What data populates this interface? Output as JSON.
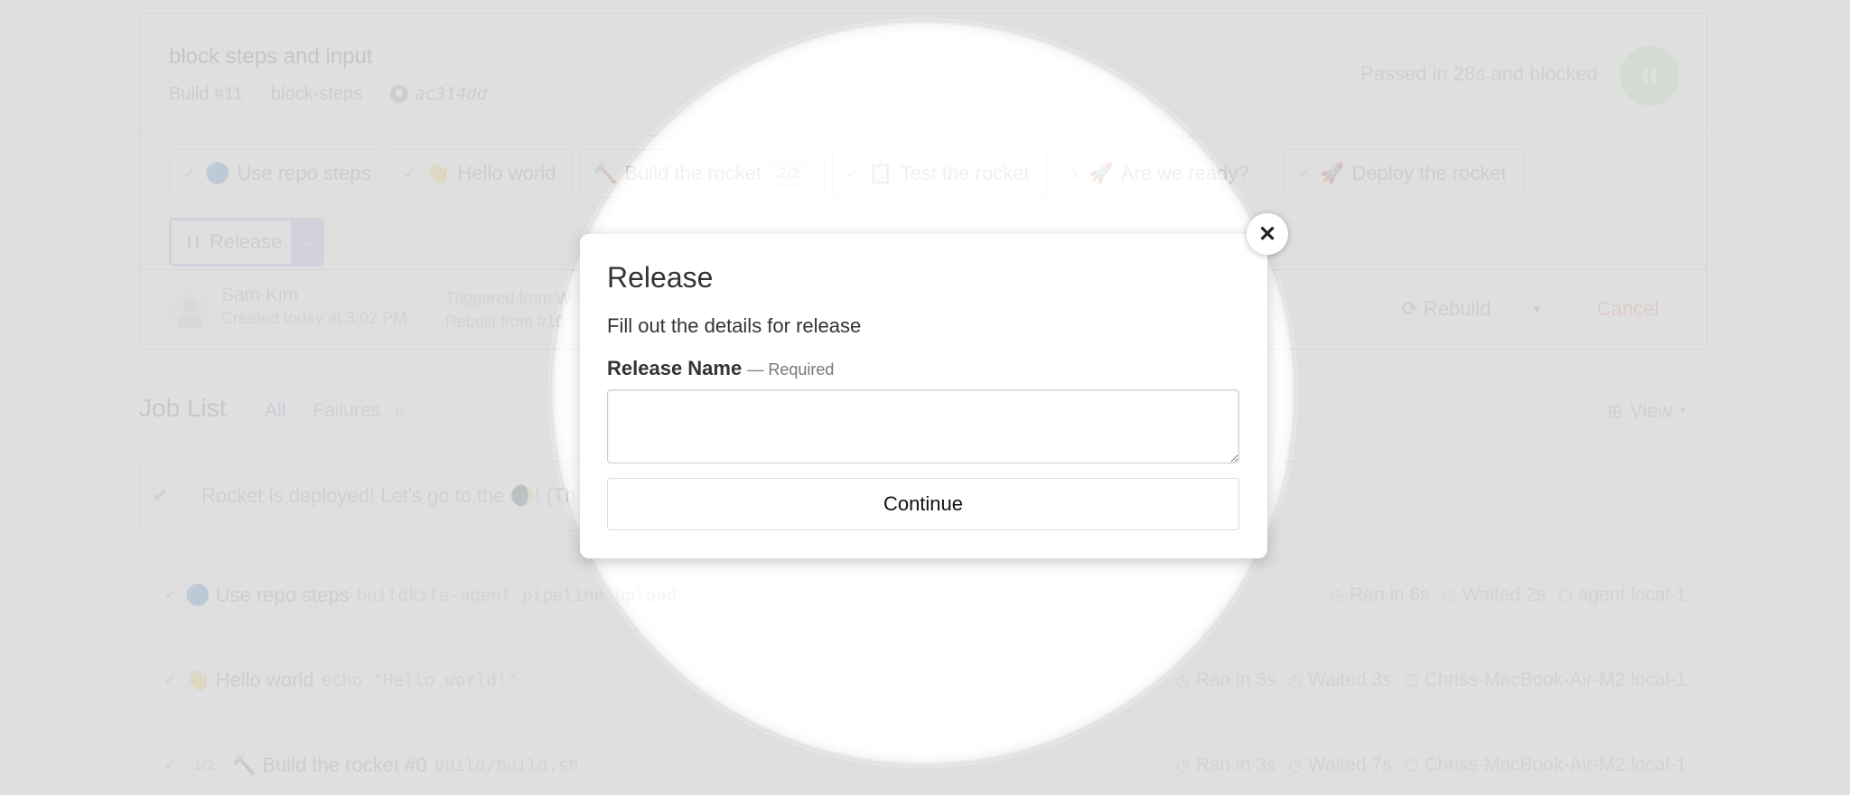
{
  "build": {
    "title": "block steps and input",
    "number": "Build #11",
    "branch": "block-steps",
    "commit": "ac314dd",
    "status_text": "Passed in 28s and blocked",
    "status_color": "#b7e5aa",
    "status_icon": "pause-icon"
  },
  "pipeline_steps": [
    {
      "state": "passed",
      "emoji": "🔵",
      "label": "Use repo steps"
    },
    {
      "state": "passed",
      "emoji": "👋",
      "label": "Hello world"
    },
    {
      "state": "passed",
      "emoji": "🔨",
      "label": "Build the rocket",
      "count": "2/2"
    },
    {
      "state": "passed",
      "emoji": "📋",
      "label": "Test the rocket"
    },
    {
      "state": "wait",
      "emoji": "🚀",
      "label": "Are we ready?"
    },
    {
      "state": "passed",
      "emoji": "🚀",
      "label": "Deploy the rocket"
    }
  ],
  "release_step": {
    "label": "Release",
    "state": "blocked",
    "accent": "#b4a4f0"
  },
  "creator": {
    "name": "Sam Kim",
    "created": "Created today at 3:02 PM",
    "triggered": "Triggered from W",
    "rebuilt": "Rebuilt from #10"
  },
  "actions": {
    "rebuild_label": "Rebuild",
    "cancel_label": "Cancel"
  },
  "job_list": {
    "title": "Job List",
    "filter_all": "All",
    "filter_failures": "Failures",
    "failures_count": "0",
    "view_label": "View"
  },
  "annotation": {
    "text": "Rocket is deployed! Let's go to the 🌒! (Th"
  },
  "jobs": [
    {
      "emoji": "🔵",
      "name": "Use repo steps",
      "command": "buildkite-agent pipeline upload",
      "ran": "Ran in 6s",
      "waited": "Waited 2s",
      "agent": "agent.local-1"
    },
    {
      "emoji": "👋",
      "name": "Hello world",
      "command": "echo \"Hello world!\"",
      "ran": "Ran in 3s",
      "waited": "Waited 3s",
      "agent": "Chriss-MacBook-Air-M2.local-1"
    },
    {
      "parallel": "1/2",
      "emoji": "🔨",
      "name": "Build the rocket #0",
      "command": "build/build.sh",
      "ran": "Ran in 3s",
      "waited": "Waited 7s",
      "agent": "Chriss-MacBook-Air-M2.local-1"
    }
  ],
  "modal": {
    "title": "Release",
    "description": "Fill out the details for release",
    "field_label": "Release Name",
    "field_required": "— Required",
    "field_value": "",
    "continue_label": "Continue",
    "close_icon": "✕"
  }
}
